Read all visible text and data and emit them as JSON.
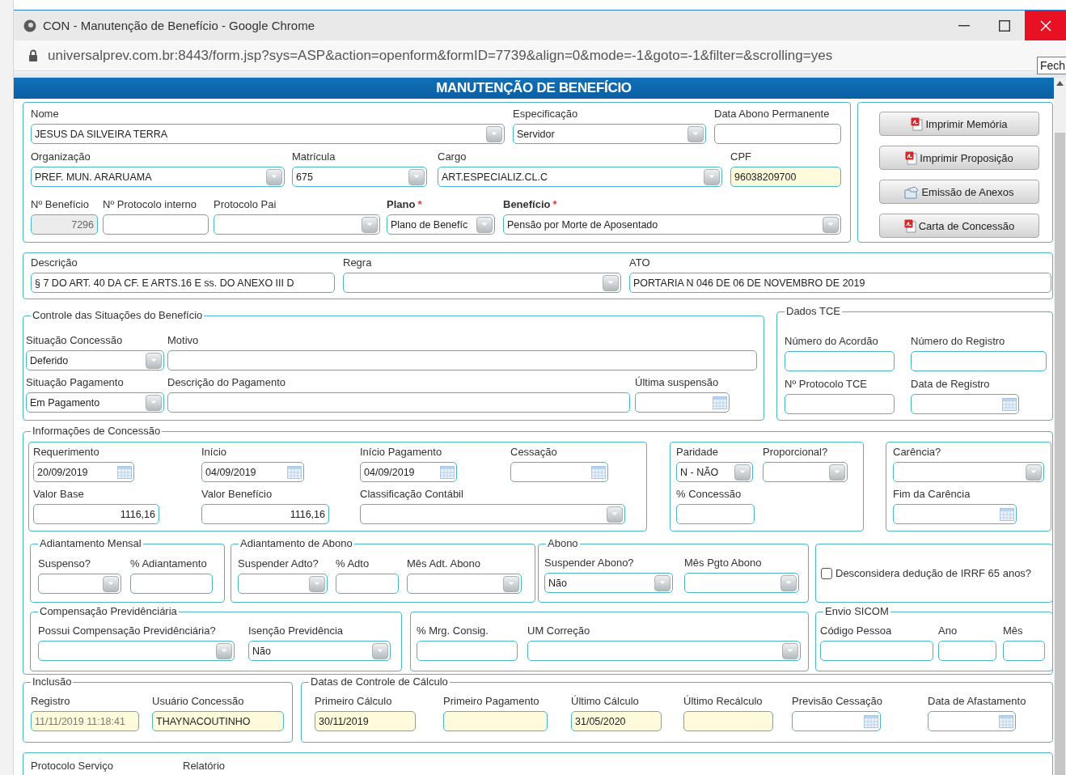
{
  "window": {
    "title": "CON - Manutenção de Benefício - Google Chrome",
    "url": "universalprev.com.br:8443/form.jsp?sys=ASP&action=openform&formID=7739&align=0&mode=-1&goto=-1&filter=&scrolling=yes",
    "tooltip": "Fech"
  },
  "form": {
    "title": "MANUTENÇÃO DE BENEFÍCIO"
  },
  "sections": [
    {
      "kind": "fields",
      "lines": [
        [
          {
            "label": "Nome",
            "kind": "select",
            "value": "JESUS DA SILVEIRA TERRA"
          },
          {
            "label": "Especificação",
            "kind": "select",
            "value": "Servidor"
          },
          {
            "label": "Data Abono Permanente",
            "kind": "text"
          }
        ],
        [
          {
            "label": "Organização",
            "kind": "select",
            "value": "PREF. MUN. ARARUAMA"
          },
          {
            "label": "Matrícula",
            "kind": "select",
            "value": "675"
          },
          {
            "label": "Cargo",
            "kind": "select",
            "value": "ART.ESPECIALIZ.CL.C"
          },
          {
            "label": "CPF",
            "kind": "locked",
            "value": "96038209700"
          }
        ],
        [
          {
            "label": "Nº Benefício",
            "kind": "grey",
            "value": "7296"
          },
          {
            "label": "Nº Protocolo interno",
            "kind": "text"
          },
          {
            "label": "Protocolo Pai",
            "kind": "select"
          },
          {
            "label": "Plano",
            "mark": "*",
            "kind": "select",
            "value": "Plano de Benefíc"
          },
          {
            "label": "Benefício",
            "mark": "*",
            "kind": "select",
            "value": "Pensão por Morte de Aposentado"
          }
        ]
      ]
    },
    {
      "kind": "buttons",
      "buttons": [
        {
          "label": "Imprimir Memória",
          "kind": "pdf"
        },
        {
          "label": "Imprimir Proposição",
          "kind": "pdf"
        },
        {
          "label": "Emissão de Anexos",
          "kind": "attach"
        },
        {
          "label": "Carta de Concessão",
          "kind": "pdf"
        }
      ]
    },
    {
      "kind": "fields",
      "lines": [
        [
          {
            "label": "Descrição",
            "kind": "text",
            "value": "§ 7 DO ART. 40 DA CF. E ARTS.16 E ss. DO ANEXO III D"
          },
          {
            "label": "Regra",
            "kind": "select"
          },
          {
            "label": "ATO",
            "kind": "text",
            "value": "PORTARIA N 046 DE 06 DE NOVEMBRO DE 2019"
          }
        ]
      ]
    },
    {
      "kind": "fields",
      "legend": "Controle das Situações do Benefício",
      "lines": [
        [
          {
            "label": "Situação Concessão",
            "kind": "select",
            "value": "Deferido"
          },
          {
            "label": "Motivo",
            "kind": "text"
          }
        ],
        [
          {
            "label": "Situação Pagamento",
            "kind": "select",
            "value": "Em Pagamento"
          },
          {
            "label": "Descrição do Pagamento",
            "kind": "text"
          },
          {
            "label": "Última suspensão",
            "kind": "date"
          }
        ]
      ]
    },
    {
      "kind": "fields",
      "legend": "Dados TCE",
      "lines": [
        [
          {
            "label": "Número do Acordão",
            "kind": "text"
          },
          {
            "label": "Número do Registro",
            "kind": "text"
          }
        ],
        [
          {
            "label": "Nº Protocolo TCE",
            "kind": "text"
          },
          {
            "label": "Data de Registro",
            "kind": "date"
          }
        ]
      ]
    },
    {
      "kind": "group",
      "legend": "Informações de Concessão",
      "panels": [
        {
          "lines": [
            [
              {
                "label": "Requerimento",
                "kind": "date",
                "value": "20/09/2019"
              },
              {
                "label": "Início",
                "kind": "date",
                "value": "04/09/2019"
              },
              {
                "label": "Início Pagamento",
                "kind": "date",
                "value": "04/09/2019"
              },
              {
                "label": "Cessação",
                "kind": "date"
              }
            ],
            [
              {
                "label": "Valor Base",
                "kind": "number",
                "value": "1116,16"
              },
              {
                "label": "Valor Benefício",
                "kind": "number",
                "value": "1116,16"
              },
              {
                "label": "Classificação Contábil",
                "kind": "select"
              }
            ]
          ]
        },
        {
          "lines": [
            [
              {
                "label": "Paridade",
                "kind": "select",
                "value": "N - NÃO"
              },
              {
                "label": "Proporcional?",
                "kind": "select"
              }
            ],
            [
              {
                "label": "% Concessão",
                "kind": "text"
              }
            ]
          ]
        },
        {
          "lines": [
            [
              {
                "label": "Carência?",
                "kind": "select"
              }
            ],
            [
              {
                "label": "Fim da Carência",
                "kind": "date"
              }
            ]
          ]
        },
        {
          "legend": "Adiantamento Mensal",
          "lines": [
            [
              {
                "label": "Suspenso?",
                "kind": "select"
              },
              {
                "label": "% Adiantamento",
                "kind": "text"
              }
            ]
          ]
        },
        {
          "legend": "Adiantamento de Abono",
          "lines": [
            [
              {
                "label": "Suspender Adto?",
                "kind": "select"
              },
              {
                "label": "% Adto",
                "kind": "text"
              },
              {
                "label": "Mês Adt. Abono",
                "kind": "select"
              }
            ]
          ]
        },
        {
          "legend": "Abono",
          "lines": [
            [
              {
                "label": "Suspender Abono?",
                "kind": "select",
                "value": "Não"
              },
              {
                "label": "Mês Pgto Abono",
                "kind": "select"
              }
            ]
          ]
        },
        {
          "lines": [
            [
              {
                "label": "Desconsidera dedução de IRRF 65 anos?",
                "kind": "checkbox",
                "checked": false
              }
            ]
          ]
        },
        {
          "legend": "Compensação Previdênciária",
          "lines": [
            [
              {
                "label": "Possui Compensação Previdênciária?",
                "kind": "select"
              },
              {
                "label": "Isenção Previdência",
                "kind": "select",
                "value": "Não"
              }
            ]
          ]
        },
        {
          "lines": [
            [
              {
                "label": "% Mrg. Consig.",
                "kind": "text"
              },
              {
                "label": "UM Correção",
                "kind": "select"
              }
            ]
          ]
        },
        {
          "legend": "Envio SICOM",
          "lines": [
            [
              {
                "label": "Código Pessoa",
                "kind": "text"
              },
              {
                "label": "Ano",
                "kind": "text"
              },
              {
                "label": "Mês",
                "kind": "text"
              }
            ]
          ]
        }
      ]
    },
    {
      "kind": "fields",
      "legend": "Inclusão",
      "lines": [
        [
          {
            "label": "Registro",
            "kind": "stamp",
            "value": "11/11/2019 11:18:41"
          },
          {
            "label": "Usuário Concessão",
            "kind": "locked",
            "value": "THAYNACOUTINHO"
          }
        ]
      ]
    },
    {
      "kind": "fields",
      "legend": "Datas de Controle de Cálculo",
      "lines": [
        [
          {
            "label": "Primeiro Cálculo",
            "kind": "locked",
            "value": "30/11/2019"
          },
          {
            "label": "Primeiro Pagamento",
            "kind": "locked"
          },
          {
            "label": "Último Cálculo",
            "kind": "locked",
            "value": "31/05/2020"
          },
          {
            "label": "Último Recálculo",
            "kind": "locked"
          },
          {
            "label": "Previsão Cessação",
            "kind": "date"
          },
          {
            "label": "Data de Afastamento",
            "kind": "date"
          }
        ]
      ]
    },
    {
      "kind": "fields",
      "lines": [
        [
          {
            "label": "Protocolo Serviço",
            "kind": "label"
          },
          {
            "label": "Relatório",
            "kind": "label"
          }
        ]
      ]
    }
  ]
}
